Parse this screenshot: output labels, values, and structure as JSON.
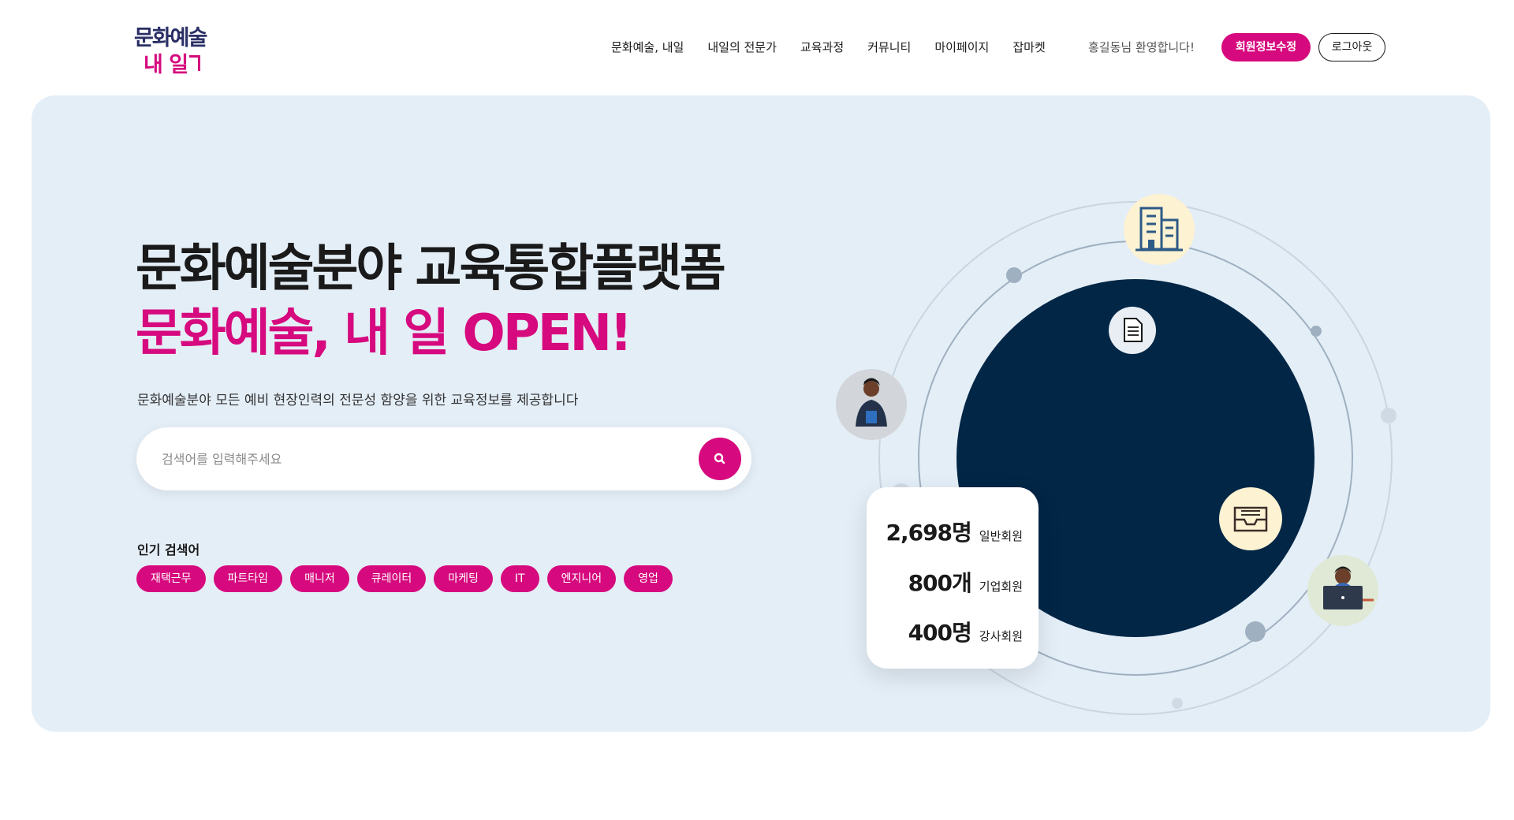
{
  "logo": {
    "line1": "문화예술",
    "line2": "내 일"
  },
  "nav": {
    "items": [
      "문화예술, 내일",
      "내일의 전문가",
      "교육과정",
      "커뮤니티",
      "마이페이지",
      "잡마켓"
    ],
    "welcome": "홍길동님 환영합니다!",
    "edit_label": "회원정보수정",
    "logout_label": "로그아웃"
  },
  "hero": {
    "title_line1": "문화예술분야 교육통합플랫폼",
    "title_line2": "문화예술, 내 일 OPEN!",
    "description": "문화예술분야 모든 예비 현장인력의 전문성 함양을 위한 교육정보를 제공합니다"
  },
  "search": {
    "placeholder": "검색어를 입력해주세요",
    "value": "",
    "icon": "search-icon"
  },
  "popular": {
    "label": "인기 검색어",
    "tags": [
      "재택근무",
      "파트타임",
      "매니저",
      "큐레이터",
      "마케팅",
      "IT",
      "엔지니어",
      "영업"
    ]
  },
  "stats": [
    {
      "value": "2,698명",
      "label": "일반회원"
    },
    {
      "value": "800개",
      "label": "기업회원"
    },
    {
      "value": "400명",
      "label": "강사회원"
    }
  ],
  "colors": {
    "accent": "#d6097e",
    "navy": "#012646",
    "hero_bg": "#e4eef7"
  }
}
